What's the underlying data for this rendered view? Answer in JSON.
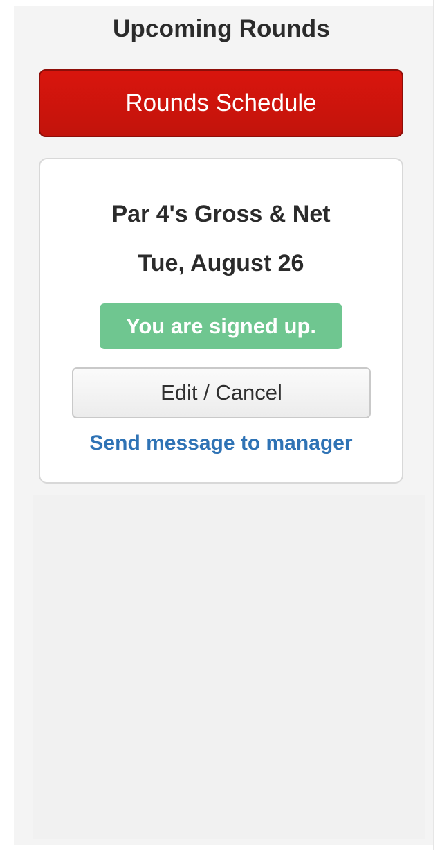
{
  "sidebar": {
    "heading": "Upcoming Rounds",
    "schedule_button_label": "Rounds Schedule"
  },
  "round_card": {
    "name": "Par 4's Gross & Net",
    "date": "Tue, August 26",
    "status": "You are signed up.",
    "edit_button_label": "Edit / Cancel",
    "message_link": "Send message to manager"
  },
  "colors": {
    "primary_button": "#d9150d",
    "status_badge": "#6fc690",
    "link": "#2f73b5"
  }
}
